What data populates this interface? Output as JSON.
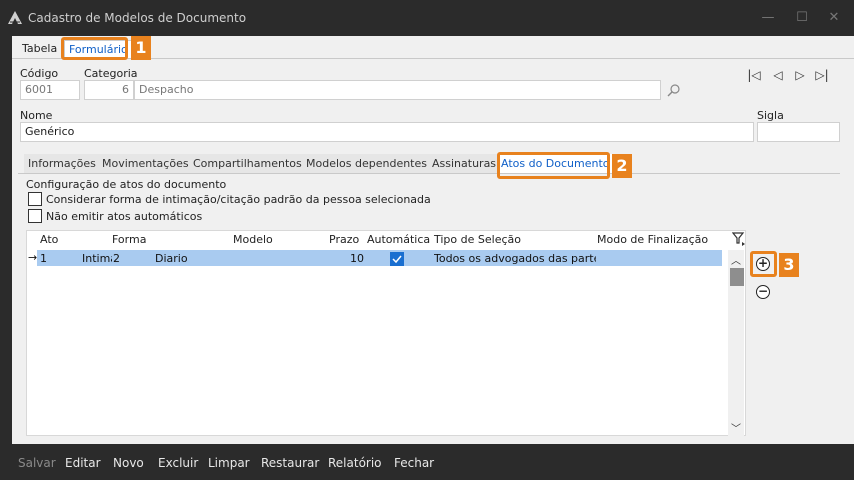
{
  "window": {
    "title": "Cadastro de Modelos de Documento",
    "logo_icon": "app-logo-icon",
    "minimize_icon": "minimize-icon",
    "maximize_icon": "maximize-icon",
    "close_icon": "close-icon"
  },
  "tabs": {
    "tabela": "Tabela",
    "formulario": "Formulário"
  },
  "callouts": {
    "one": "1",
    "two": "2",
    "three": "3"
  },
  "form": {
    "codigo_label": "Código",
    "codigo_value": "6001",
    "categoria_label": "Categoria",
    "categoria_code": "6",
    "categoria_value": "Despacho",
    "nome_label": "Nome",
    "nome_value": "Genérico",
    "sigla_label": "Sigla",
    "sigla_value": ""
  },
  "nav": {
    "first": "|◁",
    "prev": "◁",
    "next": "▷",
    "last": "▷|"
  },
  "subtabs": [
    "Informações",
    "Movimentações",
    "Compartilhamentos",
    "Modelos dependentes",
    "Assinaturas",
    "Atos do Documento"
  ],
  "config": {
    "title": "Configuração de atos do documento",
    "opt1": "Considerar forma de intimação/citação padrão da pessoa selecionada",
    "opt2": "Não emitir atos automáticos"
  },
  "grid": {
    "columns": [
      "Ato",
      "Forma",
      "Modelo",
      "Prazo",
      "Automática",
      "Tipo de Seleção",
      "Modo de Finalização"
    ],
    "row": {
      "marker": "→",
      "ato": "1",
      "forma": "Intimação",
      "forma_code": "2",
      "modelo": "Diario",
      "prazo": "10",
      "automatica": true,
      "tipo_selecao": "Todos os advogados das partes",
      "modo_finalizacao": ""
    }
  },
  "actions": {
    "add": "+",
    "remove": "−"
  },
  "toolbar": [
    "Salvar",
    "Editar",
    "Novo",
    "Excluir",
    "Limpar",
    "Restaurar",
    "Relatório",
    "Fechar"
  ],
  "colors": {
    "accent": "#e8821e",
    "selection": "#a9cbf0",
    "link": "#1060c8",
    "check": "#1a6fd0"
  }
}
